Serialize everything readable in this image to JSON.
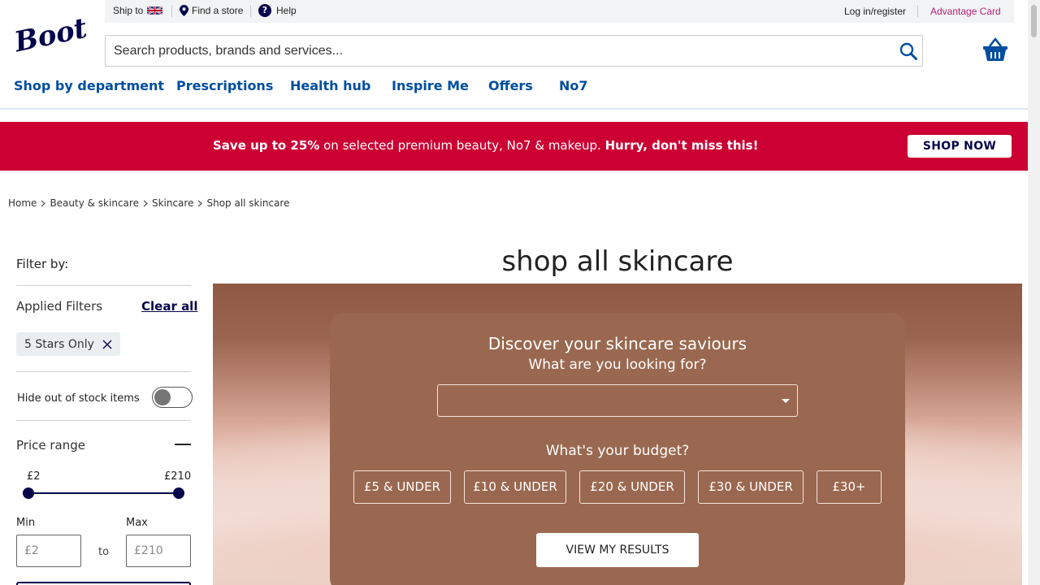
{
  "utility": {
    "ship_label": "Ship to",
    "find_store": "Find a store",
    "help": "Help",
    "help_glyph": "?",
    "login": "Log in/register",
    "advantage": "Advantage Card"
  },
  "search": {
    "placeholder": "Search products, brands and services..."
  },
  "nav": {
    "items": [
      "Shop by department",
      "Prescriptions",
      "Health hub",
      "Inspire Me",
      "Offers",
      "No7"
    ]
  },
  "promo": {
    "bold1": "Save up to 25%",
    "text": " on selected premium beauty, No7 & makeup. ",
    "bold2": "Hurry, don't miss this!",
    "button": "SHOP NOW"
  },
  "breadcrumb": [
    "Home",
    "Beauty & skincare",
    "Skincare",
    "Shop all skincare"
  ],
  "filter": {
    "title": "Filter by:",
    "applied": "Applied Filters",
    "clear": "Clear all",
    "chip": "5 Stars Only",
    "hide_stock": "Hide out of stock items",
    "price_range": "Price range",
    "range_min": "£2",
    "range_max": "£210",
    "min_label": "Min",
    "max_label": "Max",
    "min_placeholder": "£2",
    "max_placeholder": "£210",
    "to": "to"
  },
  "hero": {
    "title": "shop all skincare",
    "panel_title": "Discover your skincare saviours",
    "panel_sub": "What are you looking for?",
    "budget_title": "What's your budget?",
    "budgets": [
      "£5 & UNDER",
      "£10 & UNDER",
      "£20 & UNDER",
      "£30 & UNDER",
      "£30+"
    ],
    "view_results": "VIEW MY RESULTS"
  },
  "colors": {
    "brand_navy": "#05054b",
    "nav_blue": "#004e9f",
    "promo_red": "#cc0033",
    "advantage_pink": "#b5217a",
    "panel_brown": "#9a6850"
  }
}
